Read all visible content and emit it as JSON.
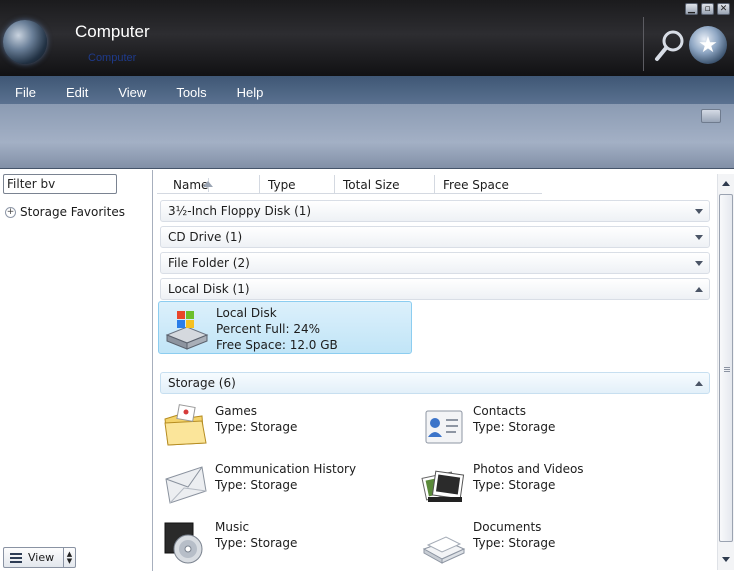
{
  "window": {
    "title": "Computer",
    "subtitle": "Computer",
    "controls": {
      "minimize": "▁",
      "maximize": "▫",
      "close": "✕"
    }
  },
  "menu": [
    "File",
    "Edit",
    "View",
    "Tools",
    "Help"
  ],
  "left": {
    "filter_value": "Filter bv",
    "favorites_label": "Storage Favorites",
    "view_button": "View"
  },
  "columns": {
    "name": "Name",
    "type": "Type",
    "total": "Total Size",
    "free": "Free Space"
  },
  "groups": {
    "floppy": "3½-Inch Floppy Disk (1)",
    "cd": "CD Drive (1)",
    "folder": "File Folder (2)",
    "local": "Local Disk (1)",
    "storage": "Storage (6)"
  },
  "local_disk": {
    "name": "Local Disk",
    "percent": "Percent Full: 24%",
    "free": "Free Space: 12.0 GB"
  },
  "storage_items": [
    {
      "name": "Games",
      "type": "Type: Storage"
    },
    {
      "name": "Contacts",
      "type": "Type: Storage"
    },
    {
      "name": "Communication History",
      "type": "Type: Storage"
    },
    {
      "name": "Photos and Videos",
      "type": "Type: Storage"
    },
    {
      "name": "Music",
      "type": "Type: Storage"
    },
    {
      "name": "Documents",
      "type": "Type: Storage"
    }
  ]
}
